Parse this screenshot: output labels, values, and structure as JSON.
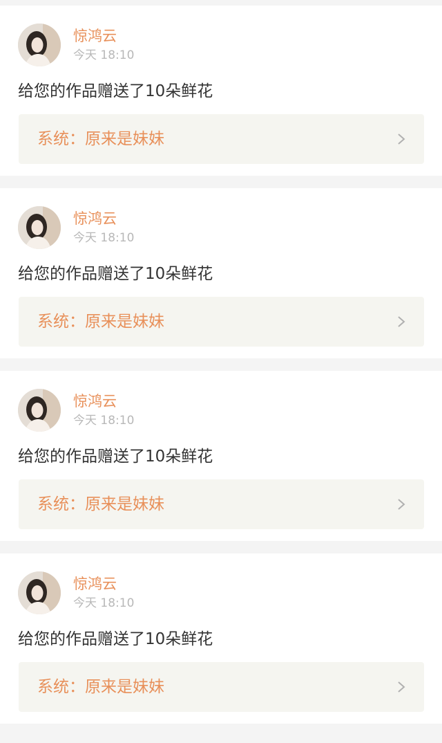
{
  "notifications": [
    {
      "username": "惊鸿云",
      "timestamp": "今天 18:10",
      "message": "给您的作品赠送了10朵鲜花",
      "reply": "系统：原来是妹妹",
      "avatar_icon": "user-avatar-photo",
      "chevron_icon": "chevron-right-icon"
    },
    {
      "username": "惊鸿云",
      "timestamp": "今天 18:10",
      "message": "给您的作品赠送了10朵鲜花",
      "reply": "系统：原来是妹妹",
      "avatar_icon": "user-avatar-photo",
      "chevron_icon": "chevron-right-icon"
    },
    {
      "username": "惊鸿云",
      "timestamp": "今天 18:10",
      "message": "给您的作品赠送了10朵鲜花",
      "reply": "系统：原来是妹妹",
      "avatar_icon": "user-avatar-photo",
      "chevron_icon": "chevron-right-icon"
    },
    {
      "username": "惊鸿云",
      "timestamp": "今天 18:10",
      "message": "给您的作品赠送了10朵鲜花",
      "reply": "系统：原来是妹妹",
      "avatar_icon": "user-avatar-photo",
      "chevron_icon": "chevron-right-icon"
    }
  ],
  "colors": {
    "accent": "#e8905a",
    "timestamp": "#b8b8b8",
    "message_text": "#333333",
    "reply_background": "#f5f5f0",
    "page_background": "#f4f4f4"
  }
}
